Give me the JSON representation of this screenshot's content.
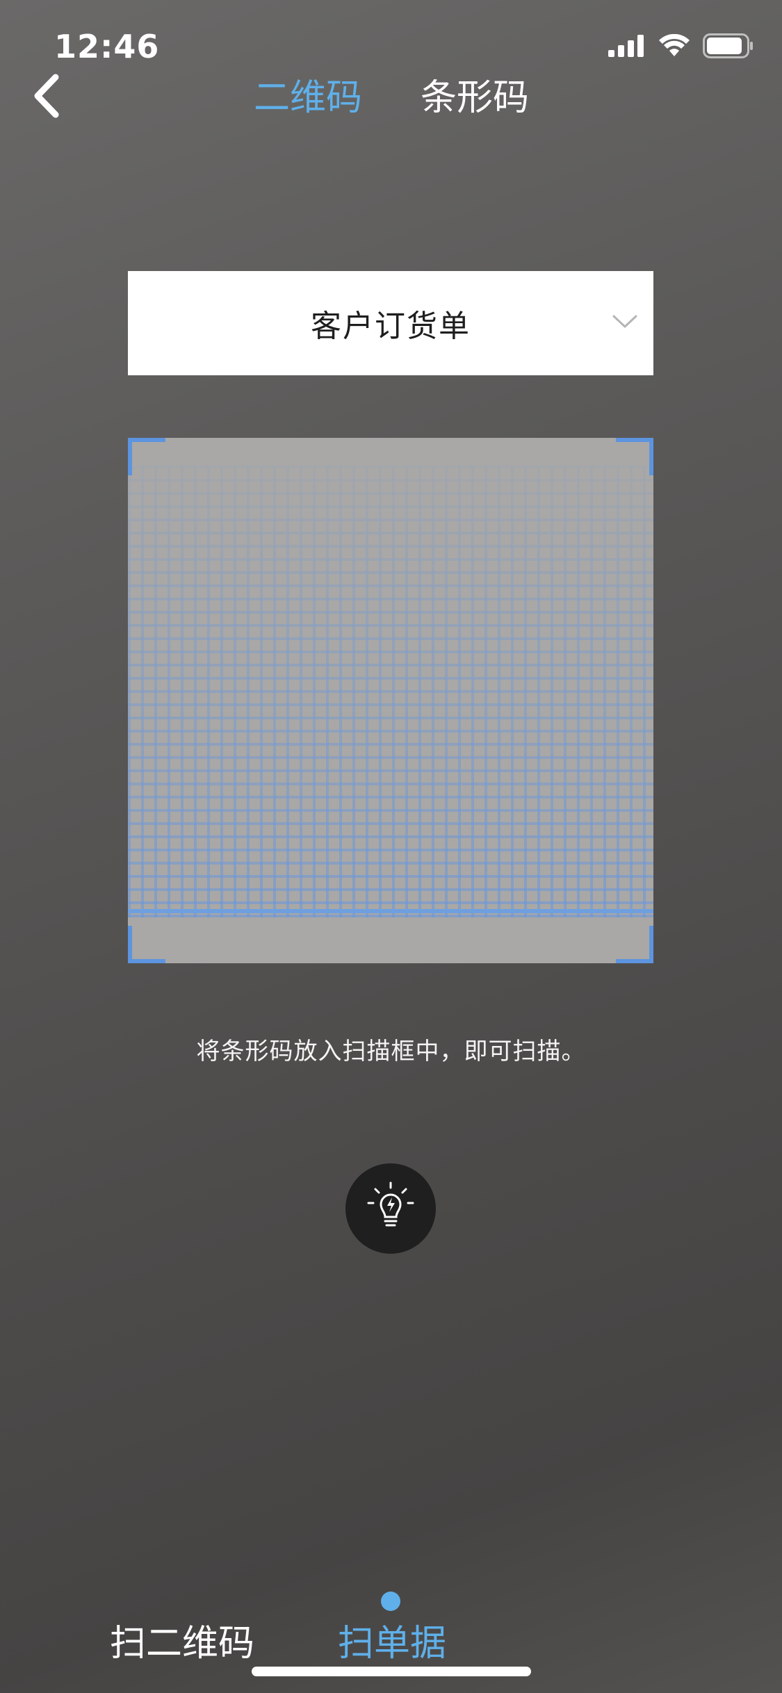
{
  "status_bar": {
    "time": "12:46",
    "icons": [
      "signal-icon",
      "wifi-icon",
      "battery-icon"
    ]
  },
  "header": {
    "back_icon": "chevron-left-icon",
    "tabs": [
      {
        "label": "二维码",
        "active": true
      },
      {
        "label": "条形码",
        "active": false
      }
    ]
  },
  "document_select": {
    "value": "客户订货单",
    "icon": "chevron-down-icon"
  },
  "scanner": {
    "hint": "将条形码放入扫描框中，即可扫描。",
    "flash_icon": "flashlight-icon"
  },
  "bottom_modes": [
    {
      "label": "扫二维码",
      "active": false
    },
    {
      "label": "扫单据",
      "active": true
    }
  ],
  "colors": {
    "accent": "#5fb0ea",
    "scan_frame_corner": "#5d94e0",
    "flash_button": "#1f1f1f"
  }
}
